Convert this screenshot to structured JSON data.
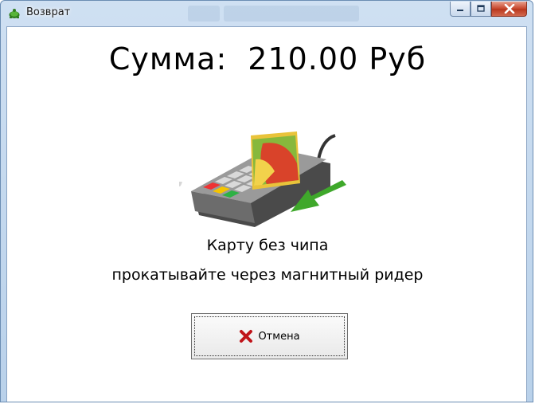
{
  "window": {
    "title": "Возврат",
    "title_icon": "turtle-app-icon",
    "controls": {
      "minimize": "minimize-icon",
      "maximize": "maximize-icon",
      "close": "close-icon"
    }
  },
  "payment": {
    "amount_label": "Сумма:",
    "amount_value": "210.00 Руб",
    "illustration": "card-terminal-illustration",
    "instruction_line1": "Карту без чипа",
    "instruction_line2": "прокатывайте через магнитный ридер"
  },
  "cancel_button": {
    "label": "Отмена",
    "icon": "red-x-icon"
  },
  "colors": {
    "titlebar": "#b9d1ea",
    "close_button": "#c7452a",
    "cancel_icon": "#c0141a",
    "arrow": "#3fa82b"
  }
}
